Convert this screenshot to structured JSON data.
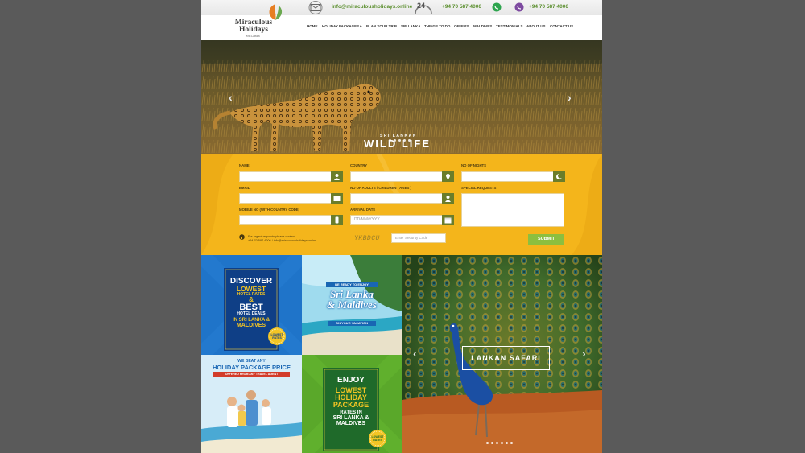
{
  "topbar": {
    "email": "info@miraculousholidays.online",
    "badge": "24",
    "whatsapp": "+94 70 587 4006",
    "viber": "+94 70 587 4006"
  },
  "logo": {
    "line1": "Miraculous",
    "line2": "Holidays",
    "sub": "Sri Lanka"
  },
  "nav": [
    "HOME",
    "HOLIDAY PACKAGES ▸",
    "PLAN YOUR TRIP",
    "SRI LANKA",
    "THINGS TO DO",
    "OFFERS",
    "MALDIVES",
    "TESTIMONIALS",
    "ABOUT US",
    "CONTACT US"
  ],
  "hero": {
    "caption_small": "SRI LANKAN",
    "caption_big": "WILD LIFE"
  },
  "form": {
    "name_label": "NAME",
    "email_label": "EMAIL",
    "mobile_label": "MOBILE NO (WITH COUNTRY CODE)",
    "country_label": "COUNTRY",
    "adults_label": "NO OF ADULTS / CHILDREN ( AGES )",
    "arrival_label": "ARRIVAL DATE",
    "arrival_placeholder": "DD/MM/YYYY",
    "nights_label": "NO OF NIGHTS",
    "special_label": "SPECIAL REQUESTS",
    "captcha_text": "YKBDCU",
    "security_placeholder": "Enter Security Code",
    "submit_label": "SUBMIT",
    "note_line1": "For urgent requests please contact",
    "note_line2": "+94 70 587 4006 / info@miraculousholidays.online"
  },
  "promo": {
    "discover": {
      "l1": "DISCOVER",
      "l2": "LOWEST",
      "l3": "HOTEL RATES",
      "l4": "&",
      "l5": "BEST",
      "l6": "HOTEL DEALS",
      "l7": "IN SRI LANKA &",
      "l8": "MALDIVES",
      "seal": "LOWEST RATES"
    },
    "enjoy_vacation": {
      "banner": "BE READY TO ENJOY",
      "script1": "Sri Lanka",
      "script2": "& Maldives",
      "footer": "ON YOUR VACATION"
    },
    "beat": {
      "l1": "WE BEAT ANY",
      "l2": "HOLIDAY PACKAGE PRICE",
      "l3": "OFFERED FROM ANY TRAVEL AGENT"
    },
    "enjoy_lowest": {
      "l1": "ENJOY",
      "l2": "LOWEST",
      "l3": "HOLIDAY",
      "l4": "PACKAGE",
      "l5": "RATES IN",
      "l6": "SRI LANKA &",
      "l7": "MALDIVES",
      "seal": "LOWEST RATES"
    },
    "safari": {
      "caption": "LANKAN SAFARI"
    }
  },
  "colors": {
    "form_bg": "#f4b51b",
    "input_btn": "#6b7d2a",
    "submit": "#8cbf3f",
    "accent_green": "#5b8f2e"
  }
}
